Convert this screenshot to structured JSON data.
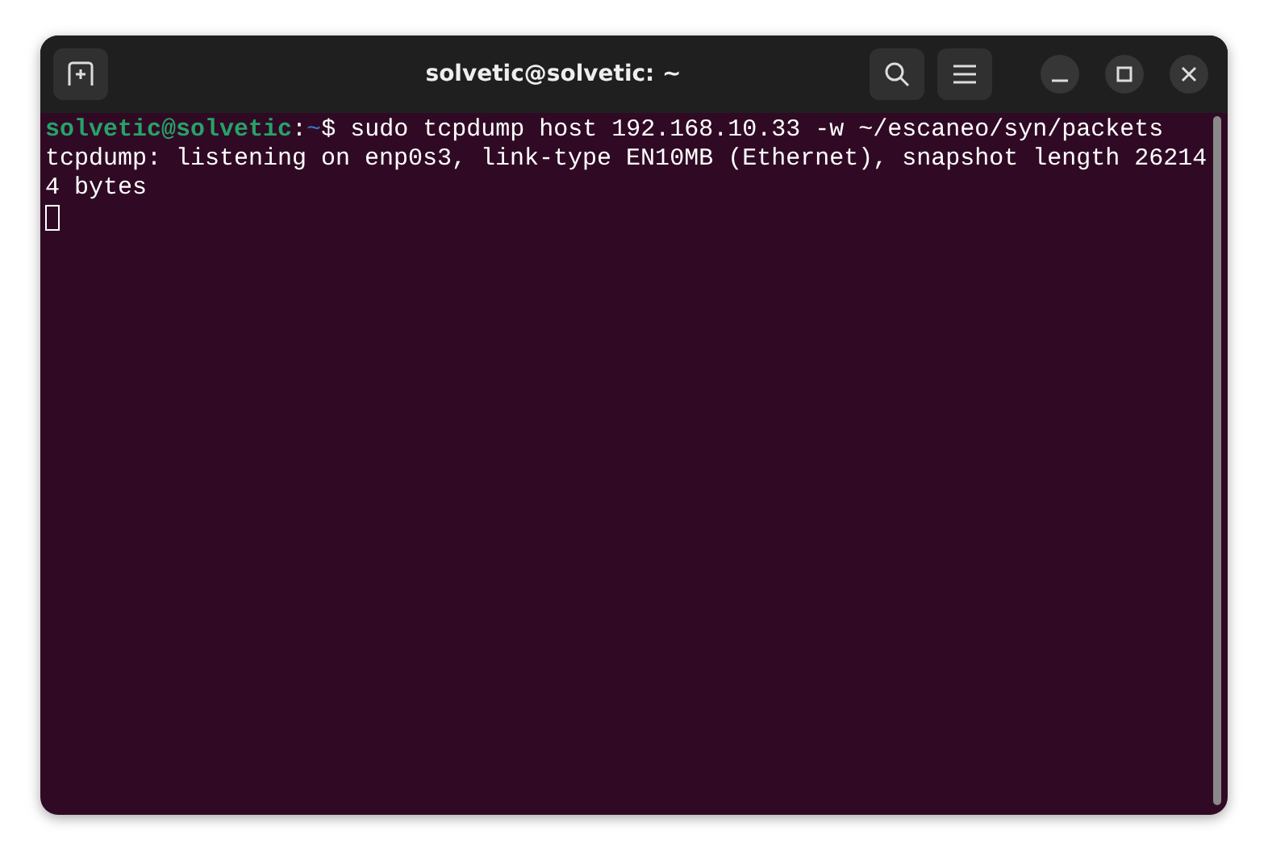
{
  "window": {
    "title": "solvetic@solvetic: ~"
  },
  "terminal": {
    "lines": [
      {
        "kind": "prompt",
        "user_host": "solvetic@solvetic",
        "separator": ":",
        "path": "~",
        "command": "$ sudo tcpdump host 192.168.10.33 -w ~/escaneo/syn/packets"
      },
      {
        "kind": "output",
        "text": "tcpdump: listening on enp0s3, link-type EN10MB (Ethernet), snapshot length 26214"
      },
      {
        "kind": "output",
        "text": "4 bytes"
      }
    ],
    "cursor": {
      "visible": true
    }
  }
}
